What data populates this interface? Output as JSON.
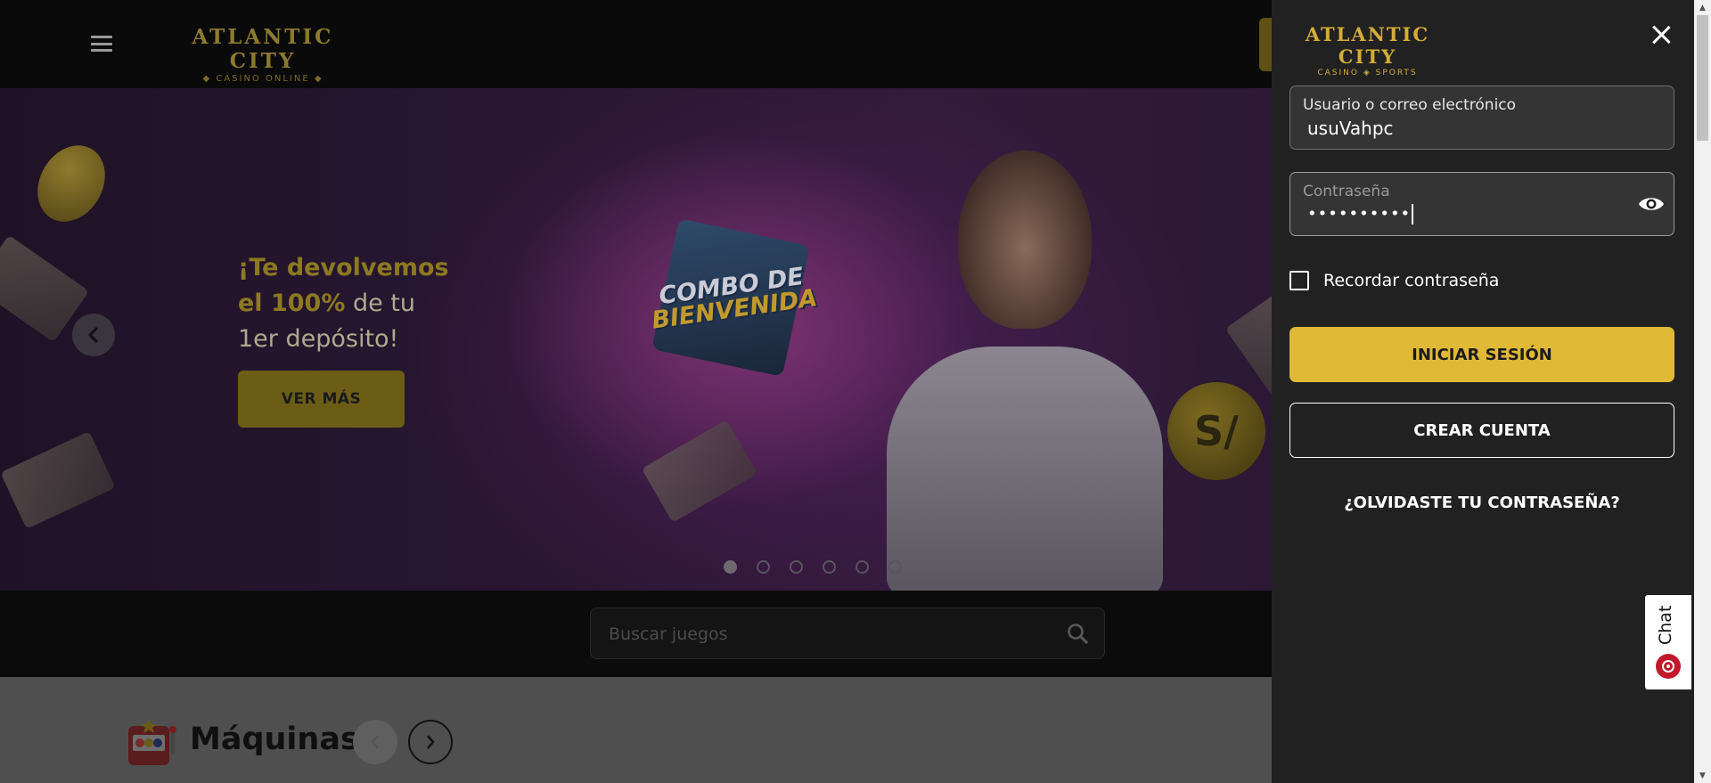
{
  "header": {
    "logo_line1": "ATLANTIC CITY",
    "logo_line2": "◆ CASINO ONLINE ◆"
  },
  "hero": {
    "headline_gold_1": "¡Te devolvemos",
    "headline_gold_2": "el 100%",
    "headline_plain_2": " de tu",
    "headline_plain_3": "1er depósito!",
    "cta_label": "VER MÁS",
    "promo_line1": "COMBO DE",
    "promo_line2": "BIENVENIDA",
    "currency_symbol": "S/",
    "slide_count": 6,
    "active_slide": 1
  },
  "search": {
    "placeholder": "Buscar juegos"
  },
  "games": {
    "section_title": "Máquinas"
  },
  "login": {
    "logo_line1": "ATLANTIC CITY",
    "logo_line2": "CASINO ◈ SPORTS",
    "username_label": "Usuario o correo electrónico",
    "username_value": "usuVahpc",
    "password_label": "Contraseña",
    "password_value": "••••••••••",
    "remember_label": "Recordar contraseña",
    "login_button": "INICIAR SESIÓN",
    "create_button": "CREAR CUENTA",
    "forgot_link": "¿OLVIDASTE TU CONTRASEÑA?"
  },
  "chat": {
    "label": "Chat"
  },
  "colors": {
    "accent_gold": "#e0b936",
    "drawer_bg": "#212121",
    "chat_red": "#c3182b"
  }
}
